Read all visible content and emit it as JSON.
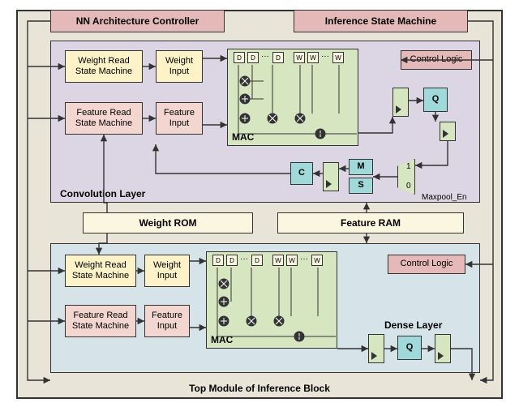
{
  "title": "Top Module of Inference Block",
  "top_blocks": {
    "nn_arch": "NN Architecture Controller",
    "ism": "Inference State Machine"
  },
  "conv_layer": {
    "title": "Convolution  Layer",
    "wrsm": "Weight Read\nState Machine",
    "winp": "Weight\nInput",
    "frsm": "Feature Read\nState Machine",
    "finp": "Feature\nInput",
    "mac_label": "MAC",
    "ctrl": "Control Logic",
    "Q": "Q",
    "C": "C",
    "M": "M",
    "S": "S",
    "mux_label": "Maxpool_En",
    "mux_1": "1",
    "mux_0": "0",
    "d": "D",
    "w": "W"
  },
  "mem": {
    "wrom": "Weight ROM",
    "fram": "Feature RAM"
  },
  "dense_layer": {
    "title": "Dense Layer",
    "wrsm": "Weight Read\nState Machine",
    "winp": "Weight\nInput",
    "frsm": "Feature Read\nState Machine",
    "finp": "Feature\nInput",
    "mac_label": "MAC",
    "ctrl": "Control Logic",
    "Q": "Q",
    "d": "D",
    "w": "W"
  },
  "chart_data": {
    "type": "diagram",
    "note": "Block diagram of an inference engine top module",
    "top": [
      "NN Architecture Controller",
      "Inference State Machine"
    ],
    "layers": [
      {
        "name": "Convolution Layer",
        "blocks": [
          "Weight Read State Machine",
          "Weight Input",
          "Feature Read State Machine",
          "Feature Input",
          "MAC",
          "Control Logic",
          "Q",
          "C",
          "M",
          "S",
          "Maxpool_En mux",
          "registers"
        ]
      },
      {
        "name": "Dense Layer",
        "blocks": [
          "Weight Read State Machine",
          "Weight Input",
          "Feature Read State Machine",
          "Feature Input",
          "MAC",
          "Control Logic",
          "Q",
          "registers"
        ]
      }
    ],
    "memories": [
      "Weight ROM",
      "Feature RAM"
    ],
    "edges": [
      [
        "NN Architecture Controller",
        "Convolution Layer"
      ],
      [
        "NN Architecture Controller",
        "Dense Layer"
      ],
      [
        "Inference State Machine",
        "Convolution Layer"
      ],
      [
        "Inference State Machine",
        "Dense Layer"
      ],
      [
        "Weight Read State Machine",
        "Weight Input",
        "conv"
      ],
      [
        "Feature Read State Machine",
        "Feature Input",
        "conv"
      ],
      [
        "Weight Input",
        "MAC",
        "conv"
      ],
      [
        "Feature Input",
        "MAC",
        "conv"
      ],
      [
        "MAC",
        "register",
        "conv"
      ],
      [
        "register",
        "Q",
        "conv"
      ],
      [
        "Q",
        "register",
        "conv"
      ],
      [
        "register",
        "Maxpool_En mux in1",
        "conv"
      ],
      [
        "M/S",
        "Maxpool_En mux in0",
        "conv"
      ],
      [
        "Maxpool_En mux",
        "C via register",
        "conv"
      ],
      [
        "C",
        "Feature Read State Machine / Feature Input (feedback)",
        "conv"
      ],
      [
        "Weight ROM",
        "Weight Read State Machine",
        "both"
      ],
      [
        "Feature RAM",
        "Feature Read State Machine",
        "both"
      ],
      [
        "Weight Read State Machine",
        "Weight Input",
        "dense"
      ],
      [
        "Feature Read State Machine",
        "Feature Input",
        "dense"
      ],
      [
        "Weight Input",
        "MAC",
        "dense"
      ],
      [
        "Feature Input",
        "MAC",
        "dense"
      ],
      [
        "MAC",
        "register",
        "dense"
      ],
      [
        "register",
        "Q",
        "dense"
      ],
      [
        "Q",
        "output register",
        "dense"
      ]
    ]
  }
}
